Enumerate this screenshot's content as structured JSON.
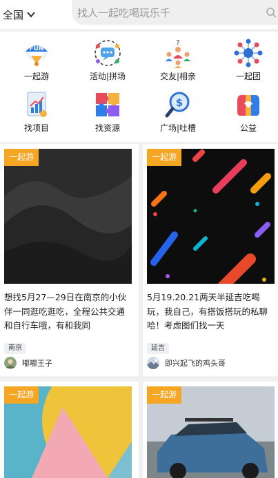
{
  "header": {
    "region_label": "全国",
    "search_placeholder": "找人一起吃喝玩乐千"
  },
  "categories": [
    {
      "label": "一起游",
      "icon": "fun-balloon-icon"
    },
    {
      "label": "活动|拼场",
      "icon": "chat-bubble-icon"
    },
    {
      "label": "交友|相亲",
      "icon": "people-network-icon"
    },
    {
      "label": "一起团",
      "icon": "team-hub-icon"
    },
    {
      "label": "找项目",
      "icon": "project-chart-icon"
    },
    {
      "label": "找资源",
      "icon": "puzzle-icon"
    },
    {
      "label": "广场|吐槽",
      "icon": "dollar-search-icon"
    },
    {
      "label": "公益",
      "icon": "charity-hands-icon"
    }
  ],
  "cards": [
    {
      "tag": "一起游",
      "title": "想找5月27—29日在南京的小伙伴一同逛吃逛吃，全程公共交通和自行车哦，有和我同",
      "location": "南京",
      "user": "嘟嘟王子"
    },
    {
      "tag": "一起游",
      "title": "5月19.20.21两天半延吉吃喝玩，我自己，有搭饭搭玩的私聊哈！考虑图们找一天",
      "location": "延吉",
      "user": "即兴起飞的鸡头哥"
    },
    {
      "tag": "一起游"
    },
    {
      "tag": "一起游"
    }
  ],
  "colors": {
    "tag_bg": "#f5a623",
    "page_bg": "#f0f0f0"
  }
}
